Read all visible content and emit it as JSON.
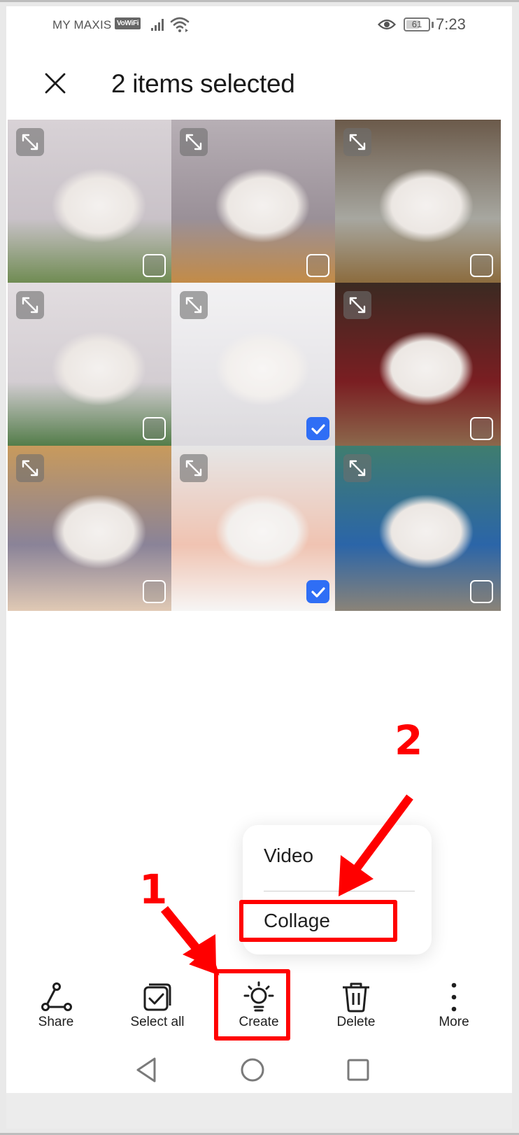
{
  "status_bar": {
    "carrier": "MY MAXIS",
    "vowifi_badge": "VoWiFi",
    "signal_icon": "signal-bars-icon",
    "wifi_icon": "wifi-icon",
    "eye_icon": "eye-comfort-icon",
    "battery_percent": "61",
    "battery_level": 0.61,
    "time": "7:23"
  },
  "header": {
    "close_icon": "close-icon",
    "title": "2 items selected"
  },
  "grid": {
    "tiles": [
      {
        "description": "Calico ragdoll cat on green mat in white corner",
        "selected": false,
        "colors": [
          "#d8d2d6",
          "#c9c2c8",
          "#6d8a4f"
        ]
      },
      {
        "description": "Ragdoll cat lying on wooden shelf",
        "selected": false,
        "colors": [
          "#b7afb5",
          "#9a9098",
          "#c48b45"
        ]
      },
      {
        "description": "Ragdoll cat by window looking up",
        "selected": false,
        "colors": [
          "#6b5a4a",
          "#a7a7a0",
          "#8b6a3b"
        ]
      },
      {
        "description": "Ragdoll cat walking on green mat near food bowls",
        "selected": false,
        "colors": [
          "#e2dde0",
          "#d3cdd2",
          "#4f7a45"
        ]
      },
      {
        "description": "Fluffy white cat peeking through wall opening",
        "selected": true,
        "colors": [
          "#ecebee",
          "#d9d7dc",
          "#c8c5cb"
        ]
      },
      {
        "description": "Cat resting in red basket",
        "selected": false,
        "colors": [
          "#3b2a22",
          "#7a1e22",
          "#8c6a4d"
        ]
      },
      {
        "description": "White cat lying upside down on yellow bedsheet",
        "selected": false,
        "colors": [
          "#c89a5c",
          "#8a8398",
          "#e0c9b4"
        ]
      },
      {
        "description": "White cat lying upside down on orange blanket",
        "selected": true,
        "colors": [
          "#d9d9d9",
          "#e8a489",
          "#f2f0ef"
        ]
      },
      {
        "description": "White cat lying beside blue flower pot",
        "selected": false,
        "colors": [
          "#3f7d6f",
          "#2b65a8",
          "#8a8378"
        ]
      }
    ],
    "expand_icon": "expand-icon",
    "check_icon": "checkmark-icon"
  },
  "popup_menu": {
    "items": [
      {
        "label": "Video"
      },
      {
        "label": "Collage"
      }
    ]
  },
  "toolbar": {
    "items": [
      {
        "label": "Share",
        "icon": "share-icon"
      },
      {
        "label": "Select all",
        "icon": "select-all-icon"
      },
      {
        "label": "Create",
        "icon": "lightbulb-icon"
      },
      {
        "label": "Delete",
        "icon": "trash-icon"
      },
      {
        "label": "More",
        "icon": "more-vertical-icon"
      }
    ]
  },
  "navbar": {
    "back_icon": "back-triangle-icon",
    "home_icon": "home-circle-icon",
    "recents_icon": "recents-square-icon"
  },
  "annotations": {
    "step1": "1",
    "step2": "2",
    "color": "#ff0000"
  },
  "colors": {
    "accent_checkbox": "#2f6ef5",
    "annotation_red": "#ff0000"
  }
}
